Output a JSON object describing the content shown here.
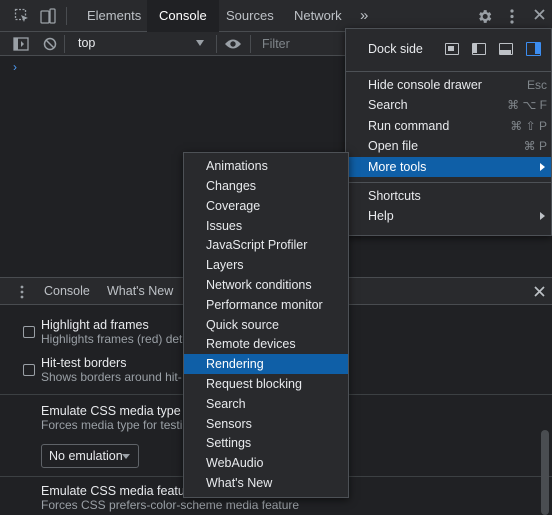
{
  "topbar": {
    "tabs": [
      {
        "label": "Elements"
      },
      {
        "label": "Console"
      },
      {
        "label": "Sources"
      },
      {
        "label": "Network"
      }
    ],
    "more_tabs": "»"
  },
  "console_toolbar": {
    "context": "top",
    "filter_placeholder": "Filter"
  },
  "console": {
    "prompt": "›"
  },
  "drawer": {
    "tabs": [
      {
        "label": "Console"
      },
      {
        "label": "What's New"
      }
    ]
  },
  "rendering": {
    "options": [
      {
        "title": "Highlight ad frames",
        "desc": "Highlights frames (red) dete"
      },
      {
        "title": "Hit-test borders",
        "desc": "Shows borders around hit-"
      }
    ],
    "media_type": {
      "title": "Emulate CSS media type",
      "desc": "Forces media type for testi",
      "value": "No emulation"
    },
    "media_feature": {
      "title": "Emulate CSS media feature",
      "desc": "Forces CSS prefers-color-scheme media feature"
    }
  },
  "main_menu": {
    "dock_side_label": "Dock side",
    "items": [
      {
        "label": "Hide console drawer",
        "shortcut": "Esc"
      },
      {
        "label": "Search",
        "shortcut": "⌘ ⌥ F"
      },
      {
        "label": "Run command",
        "shortcut": "⌘ ⇧ P"
      },
      {
        "label": "Open file",
        "shortcut": "⌘ P"
      },
      {
        "label": "More tools",
        "shortcut": ""
      },
      {
        "label": "Shortcuts",
        "shortcut": ""
      },
      {
        "label": "Help",
        "shortcut": ""
      }
    ]
  },
  "more_tools_menu": {
    "items": [
      "Animations",
      "Changes",
      "Coverage",
      "Issues",
      "JavaScript Profiler",
      "Layers",
      "Network conditions",
      "Performance monitor",
      "Quick source",
      "Remote devices",
      "Rendering",
      "Request blocking",
      "Search",
      "Sensors",
      "Settings",
      "WebAudio",
      "What's New"
    ]
  },
  "colors": {
    "accent": "#0f5fa7",
    "dock_active": "#3c8df0"
  }
}
